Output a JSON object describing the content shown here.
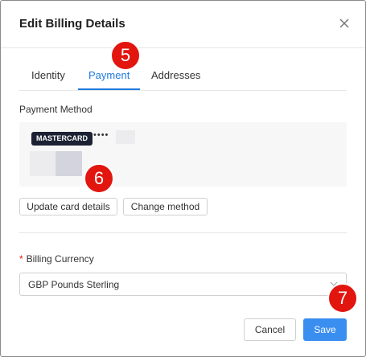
{
  "dialog": {
    "title": "Edit Billing Details",
    "close_icon": "close-icon"
  },
  "tabs": [
    {
      "label": "Identity",
      "active": false
    },
    {
      "label": "Payment",
      "active": true
    },
    {
      "label": "Addresses",
      "active": false
    }
  ],
  "payment": {
    "section_label": "Payment Method",
    "card_brand": "MASTERCARD",
    "masked_digits": "••••",
    "update_button": "Update card details",
    "change_button": "Change method"
  },
  "billing": {
    "currency_label": "Billing Currency",
    "required_marker": "*",
    "currency_value": "GBP Pounds Sterling"
  },
  "footer": {
    "cancel_label": "Cancel",
    "save_label": "Save"
  },
  "annotations": [
    "5",
    "6",
    "7"
  ],
  "colors": {
    "accent": "#1f7ae0",
    "primary_button": "#3a8ef0",
    "annotation_badge": "#e2150f",
    "card_brand_bg": "#1c2233"
  }
}
